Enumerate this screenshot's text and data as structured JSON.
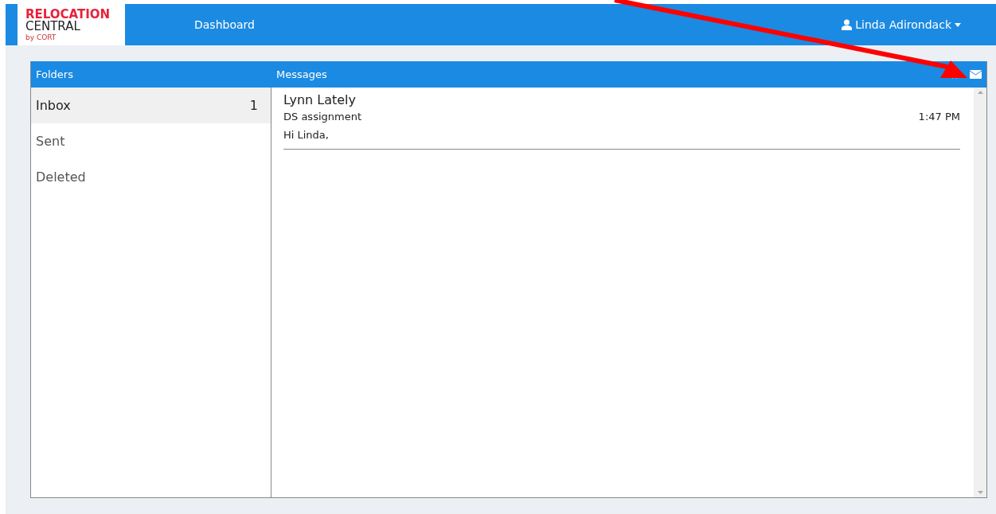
{
  "logo": {
    "line_1": "RELOCATION",
    "line_2": "CENTRAL",
    "byline": "by CORT"
  },
  "nav": {
    "links": [
      {
        "label": "Dashboard"
      }
    ],
    "user": "Linda Adirondack"
  },
  "folders": {
    "title": "Folders",
    "items": [
      {
        "label": "Inbox",
        "count": "1",
        "selected": true
      },
      {
        "label": "Sent",
        "selected": false
      },
      {
        "label": "Deleted",
        "selected": false
      }
    ]
  },
  "messages": {
    "title": "Messages",
    "items": [
      {
        "sender": "Lynn Lately",
        "subject": "DS assignment",
        "time": "1:47 PM",
        "preview": "Hi Linda,"
      }
    ]
  },
  "annotation": {
    "kind": "arrow"
  }
}
